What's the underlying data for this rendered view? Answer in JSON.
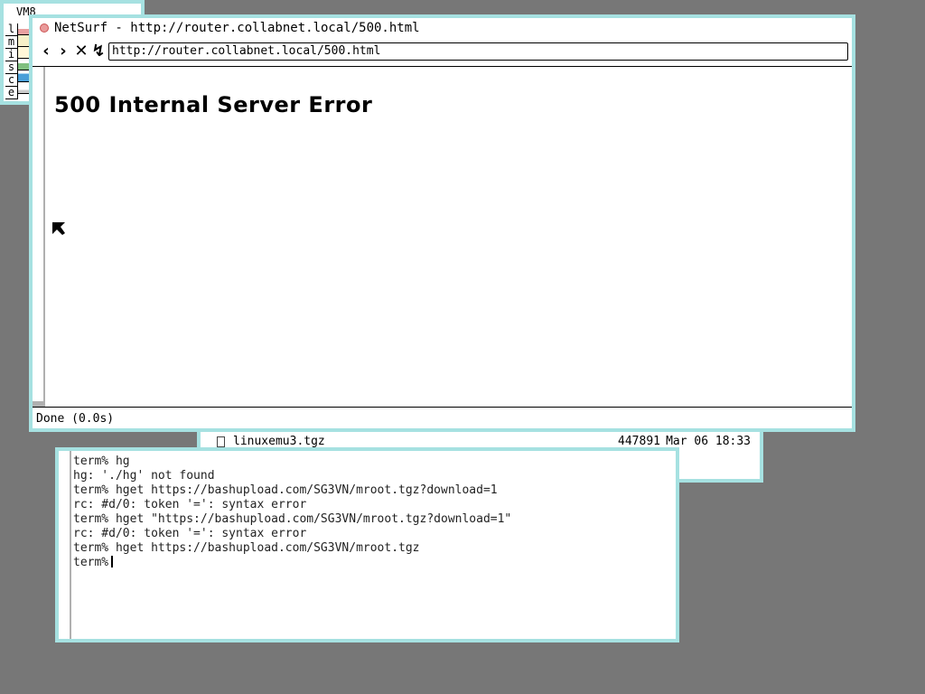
{
  "stats": {
    "title": "VM8",
    "labels": [
      "l",
      "m",
      "i",
      "s",
      "c",
      "e"
    ]
  },
  "browser": {
    "window_title": "NetSurf - http://router.collabnet.local/500.html",
    "nav": {
      "back_icon": "‹",
      "forward_icon": "›",
      "stop_icon": "✕",
      "reload_icon": "↯"
    },
    "url": "http://router.collabnet.local/500.html",
    "heading": "500 Internal Server Error",
    "status": "Done (0.0s)"
  },
  "files": {
    "rows": [
      {
        "name": "linuxemu3.tgz",
        "size": "447891",
        "date": "Mar 06 18:33"
      }
    ]
  },
  "terminal": {
    "lines": [
      "term% hg",
      "hg: './hg' not found",
      "term% hget https://bashupload.com/SG3VN/mroot.tgz?download=1",
      "rc: #d/0: token '=': syntax error",
      "term% hget \"https://bashupload.com/SG3VN/mroot.tgz?download=1\"",
      "rc: #d/0: token '=': syntax error",
      "term% hget https://bashupload.com/SG3VN/mroot.tgz"
    ],
    "prompt": "term%"
  },
  "colors": {
    "desktop": "#777777",
    "window_border": "#a6e1e1"
  }
}
